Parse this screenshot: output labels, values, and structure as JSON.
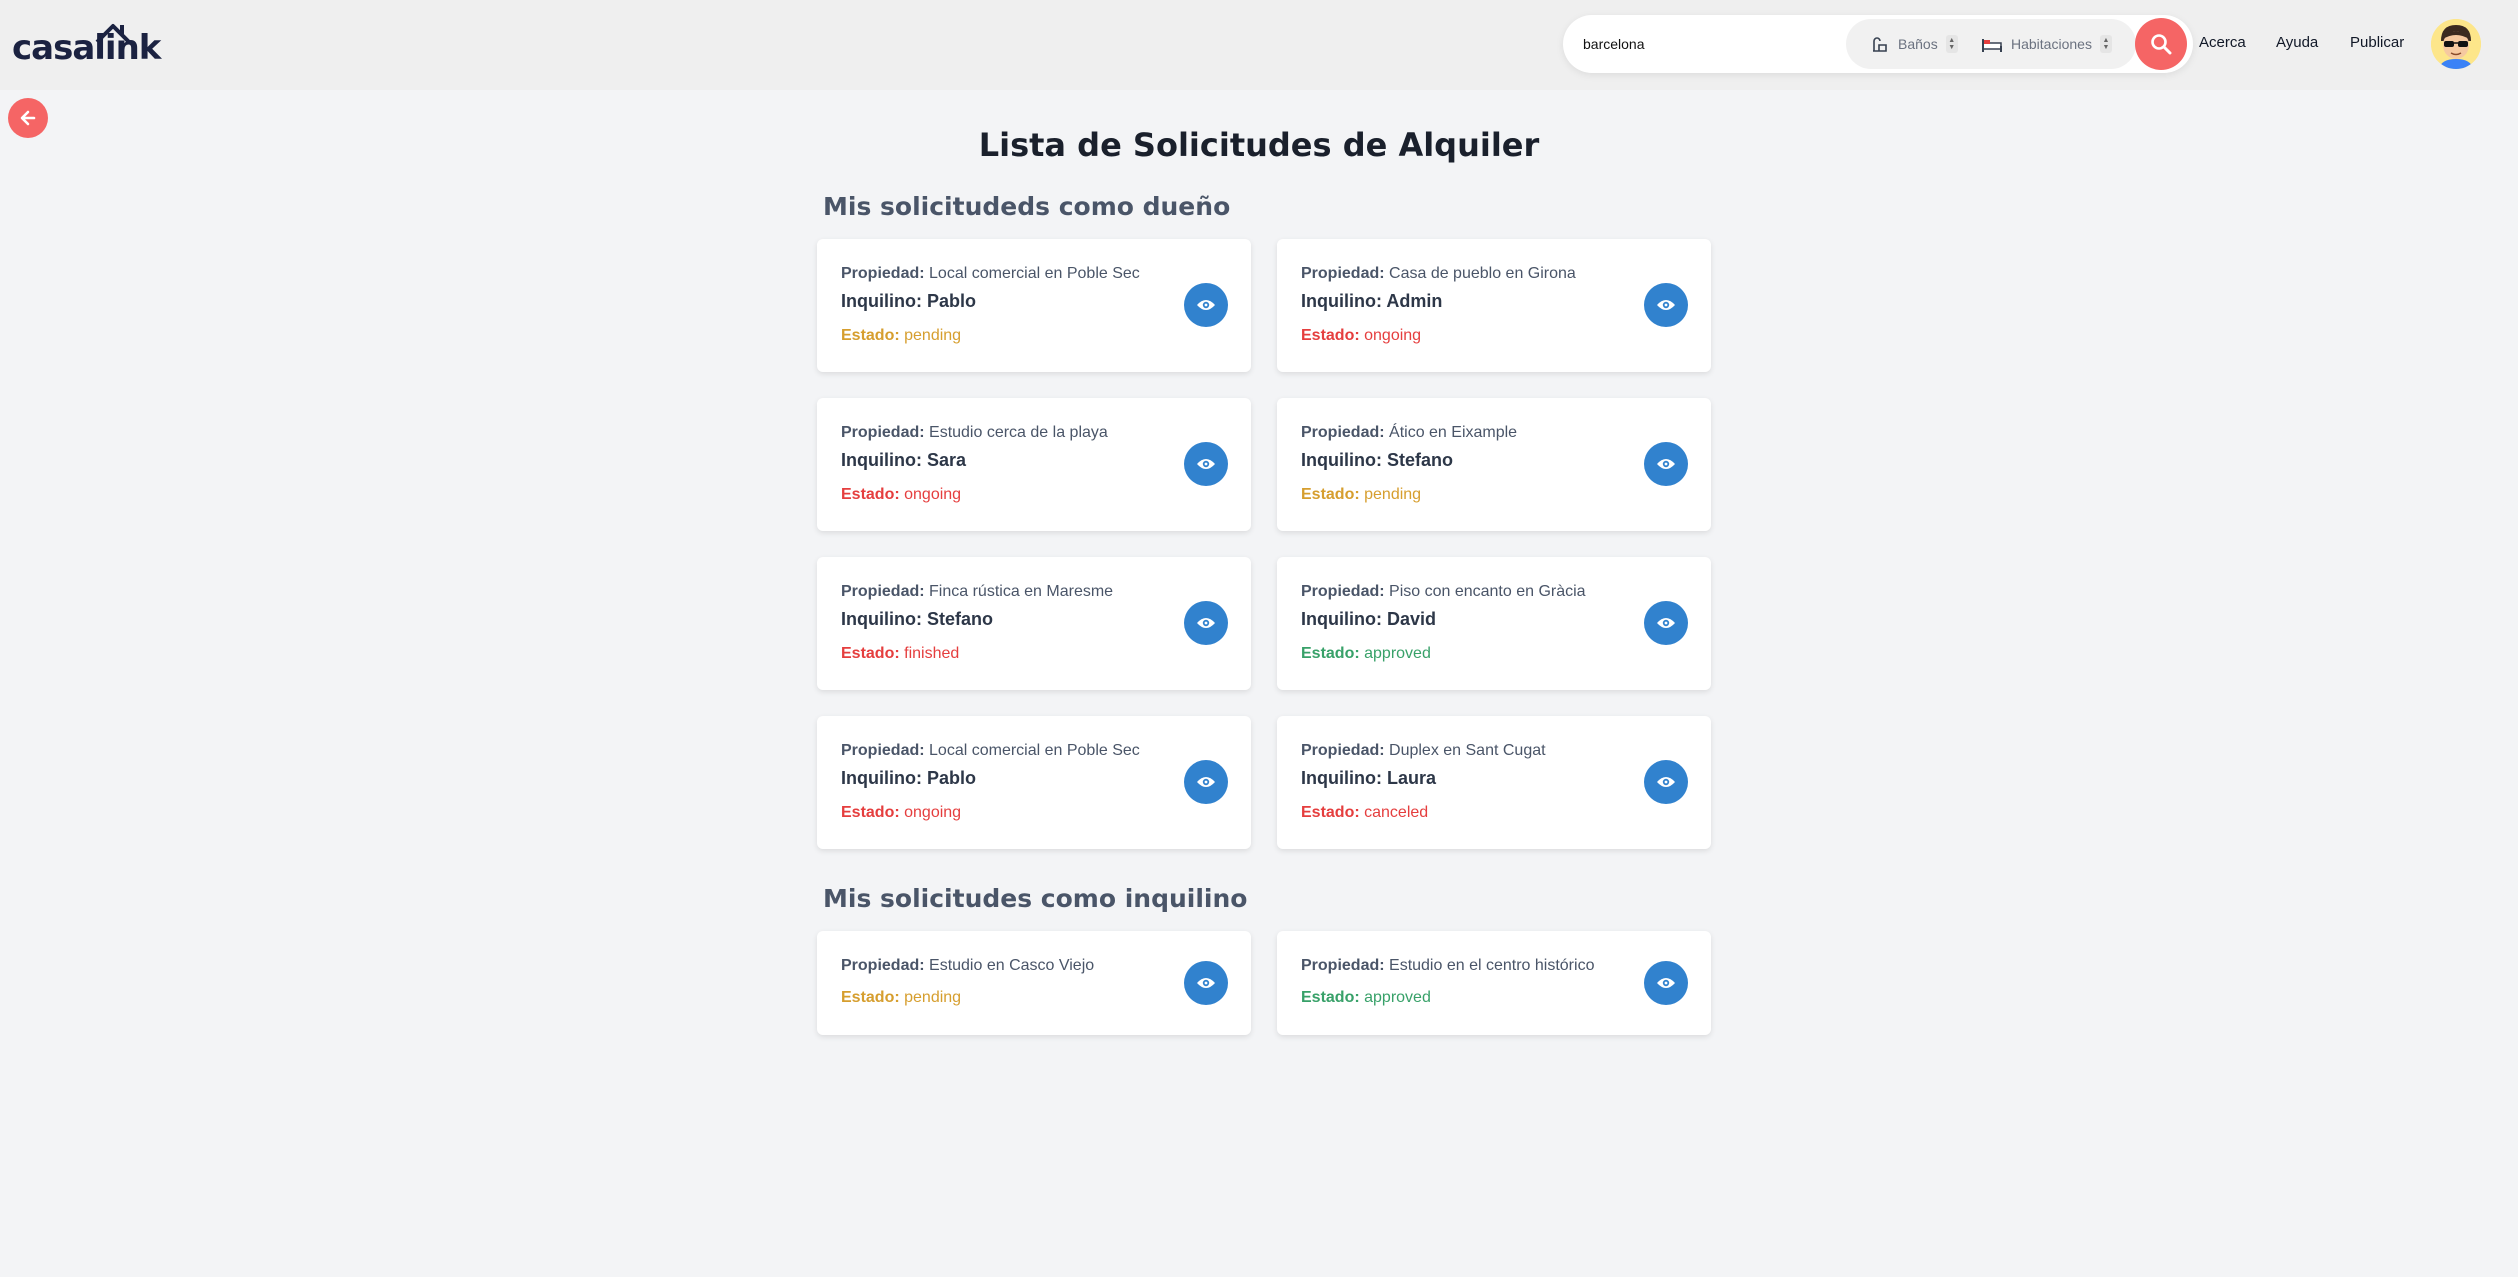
{
  "header": {
    "logo_text": "casalink",
    "search": {
      "value": "barcelona"
    },
    "filters": [
      {
        "label": "Baños",
        "icon": "bathtub-icon"
      },
      {
        "label": "Habitaciones",
        "icon": "bed-icon"
      }
    ],
    "nav": [
      "Acerca",
      "Ayuda",
      "Publicar"
    ]
  },
  "page": {
    "title": "Lista de Solicitudes de Alquiler",
    "section_owner": "Mis solicitudeds como dueño",
    "section_tenant": "Mis solicitudes como inquilino",
    "labels": {
      "property": "Propiedad:",
      "tenant": "Inquilino:",
      "status": "Estado:"
    }
  },
  "owner_requests": [
    {
      "property": "Local comercial en Poble Sec",
      "tenant": "Pablo",
      "status": "pending"
    },
    {
      "property": "Casa de pueblo en Girona",
      "tenant": "Admin",
      "status": "ongoing"
    },
    {
      "property": "Estudio cerca de la playa",
      "tenant": "Sara",
      "status": "ongoing"
    },
    {
      "property": "Ático en Eixample",
      "tenant": "Stefano",
      "status": "pending"
    },
    {
      "property": "Finca rústica en Maresme",
      "tenant": "Stefano",
      "status": "finished"
    },
    {
      "property": "Piso con encanto en Gràcia",
      "tenant": "David",
      "status": "approved"
    },
    {
      "property": "Local comercial en Poble Sec",
      "tenant": "Pablo",
      "status": "ongoing"
    },
    {
      "property": "Duplex en Sant Cugat",
      "tenant": "Laura",
      "status": "canceled"
    }
  ],
  "tenant_requests": [
    {
      "property": "Estudio en Casco Viejo",
      "status": "pending"
    },
    {
      "property": "Estudio en el centro histórico",
      "status": "approved"
    }
  ],
  "colors": {
    "accent_red": "#f56565",
    "accent_blue": "#3182ce",
    "pending": "#d69e2e",
    "danger": "#e53e3e",
    "approved": "#38a169"
  }
}
